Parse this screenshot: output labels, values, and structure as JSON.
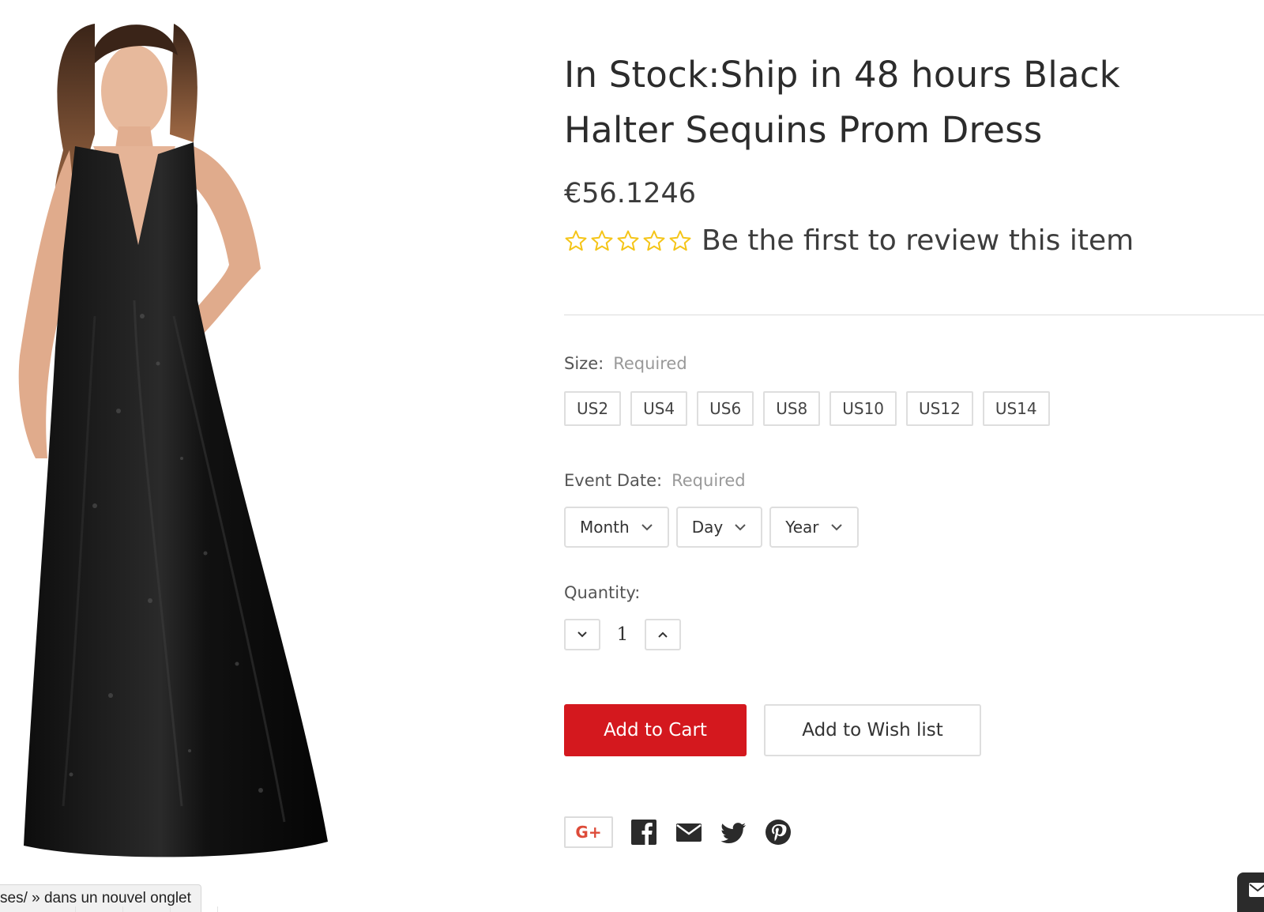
{
  "product": {
    "title": "In Stock:Ship in 48 hours Black Halter Sequins Prom Dress",
    "price": "€56.1246",
    "review_link": "Be the first to review this item",
    "rating_stars": 0,
    "max_stars": 5,
    "image_alt": "Black halter sequins prom dress"
  },
  "size": {
    "label": "Size:",
    "required": "Required",
    "options": [
      "US2",
      "US4",
      "US6",
      "US8",
      "US10",
      "US12",
      "US14"
    ]
  },
  "event_date": {
    "label": "Event Date:",
    "required": "Required",
    "month": "Month",
    "day": "Day",
    "year": "Year"
  },
  "quantity": {
    "label": "Quantity:",
    "value": "1"
  },
  "actions": {
    "add_to_cart": "Add to Cart",
    "add_to_wishlist": "Add to Wish list"
  },
  "social": {
    "gplus": "G+",
    "icons": [
      "facebook-icon",
      "email-icon",
      "twitter-icon",
      "pinterest-icon"
    ]
  },
  "status_bar": {
    "text": "ses/ » dans un nouvel onglet"
  },
  "colors": {
    "accent": "#d4181e",
    "star": "#f5c518",
    "gplus": "#dd4b39"
  }
}
